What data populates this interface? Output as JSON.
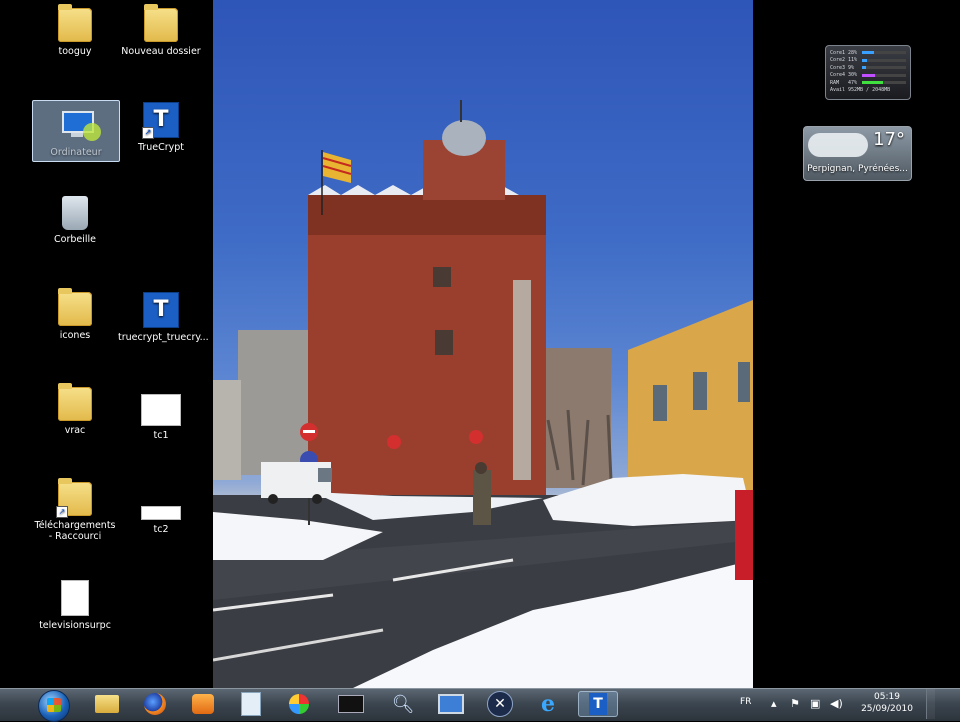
{
  "desktop": {
    "icons": [
      {
        "label": "tooguy",
        "icon": "user-folder-icon"
      },
      {
        "label": "Nouveau dossier",
        "icon": "folder-icon"
      },
      {
        "label": "Ordinateur",
        "icon": "computer-icon",
        "selected": true
      },
      {
        "label": "TrueCrypt",
        "icon": "truecrypt-icon"
      },
      {
        "label": "Corbeille",
        "icon": "recycle-bin-icon"
      },
      {
        "label": "icones",
        "icon": "folder-icon"
      },
      {
        "label": "truecrypt_truecry...",
        "icon": "truecrypt-setup-icon"
      },
      {
        "label": "vrac",
        "icon": "folder-icon"
      },
      {
        "label": "tc1",
        "icon": "document-icon"
      },
      {
        "label": "Téléchargements - Raccourci",
        "icon": "download-folder-icon"
      },
      {
        "label": "tc2",
        "icon": "document-icon"
      },
      {
        "label": "televisionsurpc",
        "icon": "media-file-icon"
      }
    ]
  },
  "gadgets": {
    "cpu_meter": {
      "rows": [
        {
          "label": "Core1",
          "pct": "28%",
          "level": 0.28,
          "color": "#3aa0ff"
        },
        {
          "label": "Core2",
          "pct": "11%",
          "level": 0.11,
          "color": "#3aa0ff"
        },
        {
          "label": "Core3",
          "pct": "9%",
          "level": 0.09,
          "color": "#3aa0ff"
        },
        {
          "label": "Core4",
          "pct": "30%",
          "level": 0.3,
          "color": "#c050ff"
        },
        {
          "label": "RAM",
          "pct": "47%",
          "level": 0.47,
          "color": "#40e040"
        },
        {
          "label": "Avail",
          "pct": "952MB / 2048MB",
          "level": 0,
          "color": "#cccccc"
        }
      ]
    },
    "weather": {
      "temperature": "17°",
      "location": "Perpignan, Pyrénées..."
    }
  },
  "taskbar": {
    "pinned": [
      {
        "name": "explorer",
        "icon": "folder-icon"
      },
      {
        "name": "firefox",
        "icon": "firefox-icon"
      },
      {
        "name": "media-player",
        "icon": "media-player-icon"
      },
      {
        "name": "notepad",
        "icon": "notepad-icon"
      },
      {
        "name": "paint",
        "icon": "paint-icon"
      },
      {
        "name": "command-prompt",
        "icon": "terminal-icon"
      },
      {
        "name": "search",
        "icon": "magnifier-icon"
      },
      {
        "name": "network",
        "icon": "network-icon"
      },
      {
        "name": "x-app",
        "icon": "x-icon"
      },
      {
        "name": "internet-explorer",
        "icon": "ie-icon"
      },
      {
        "name": "truecrypt",
        "icon": "truecrypt-icon",
        "active": true
      }
    ],
    "tray": {
      "language": "FR",
      "time": "05:19",
      "date": "25/09/2010"
    }
  }
}
